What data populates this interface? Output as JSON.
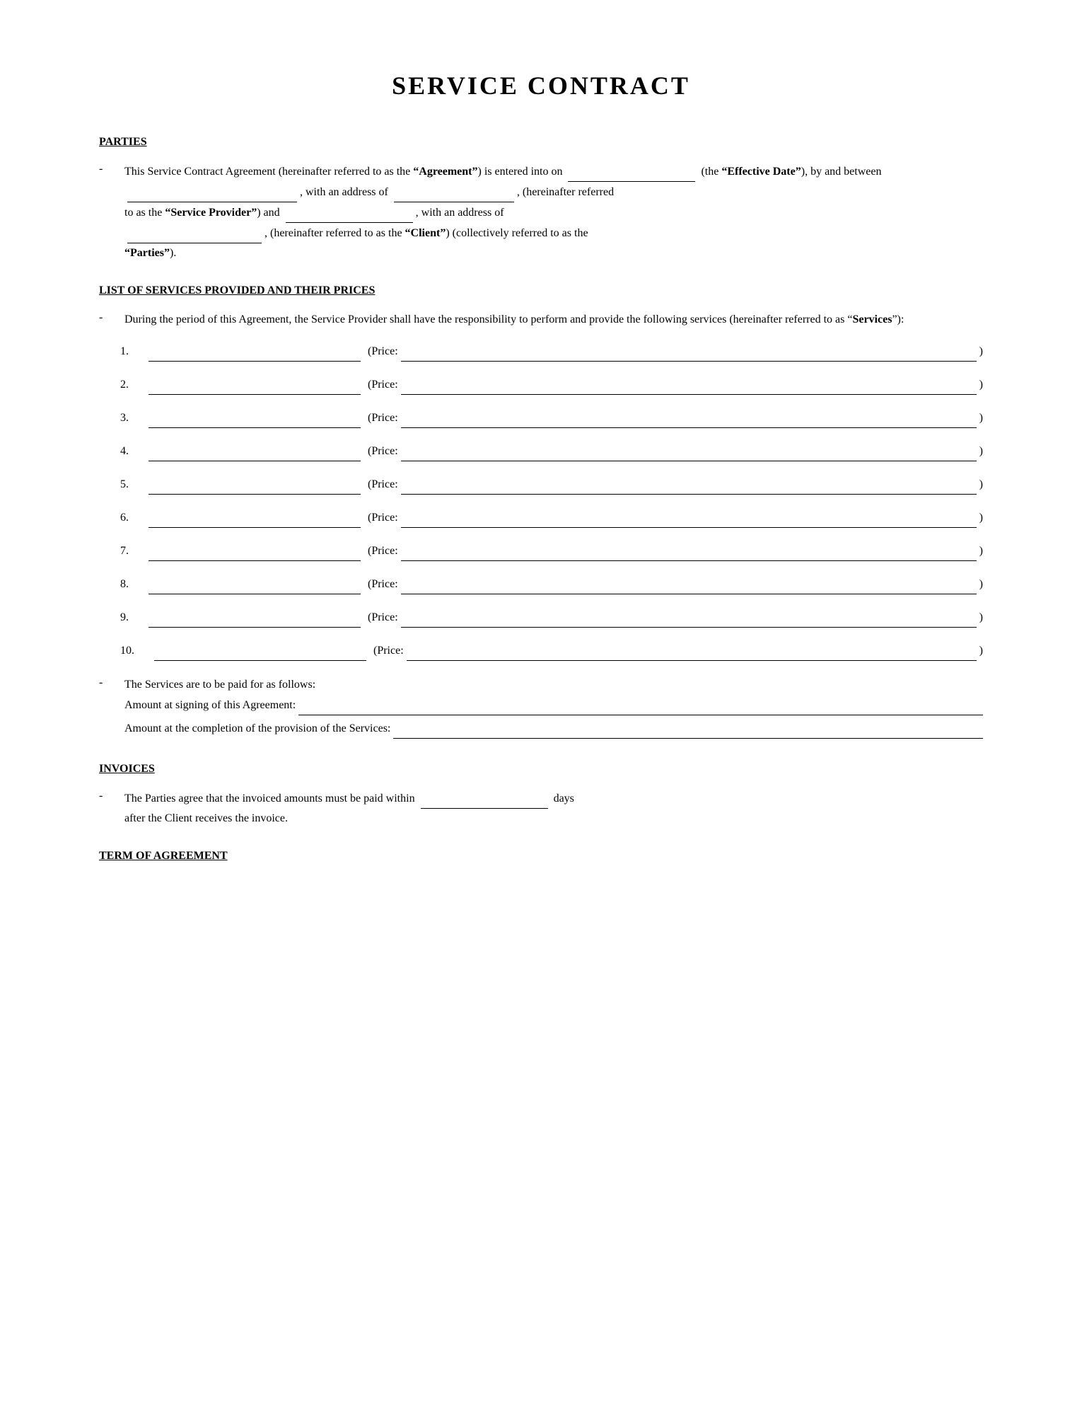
{
  "document": {
    "title": "SERVICE CONTRACT",
    "sections": {
      "parties": {
        "heading": "PARTIES",
        "paragraph": {
          "intro": "This Service Contract Agreement (hereinafter referred to as the",
          "agreement_term": "\"Agreement\"",
          "p1": ") is entered into on",
          "effective_date_term": "\"Effective Date\"",
          "p2": "), by and between",
          "p3": ", with an address of",
          "p4": ", (hereinafter referred to as",
          "service_provider_term": "\"Service Provider\"",
          "p5": ") and",
          "p6": ", with an address of",
          "p7": ", (hereinafter referred to as the",
          "client_term": "\"Client\"",
          "p8": ") (collectively referred to as the",
          "parties_term": "\"Parties\"",
          "p9": ")."
        }
      },
      "services": {
        "heading": "LIST OF SERVICES PROVIDED AND THEIR PRICES",
        "intro": "During the period of this Agreement, the Service Provider shall have the responsibility to perform and provide the following services (hereinafter referred to as “Services”):",
        "items": [
          {
            "num": "1."
          },
          {
            "num": "2."
          },
          {
            "num": "3."
          },
          {
            "num": "4."
          },
          {
            "num": "5."
          },
          {
            "num": "6."
          },
          {
            "num": "7."
          },
          {
            "num": "8."
          },
          {
            "num": "9."
          },
          {
            "num": "10."
          }
        ],
        "payment": {
          "intro": "The Services are to be paid for as follows:",
          "signing_label": "Amount at signing of this Agreement:",
          "completion_label": "Amount at the completion of the provision of the Services:"
        }
      },
      "invoices": {
        "heading": "INVOICES",
        "paragraph": "The Parties agree that the invoiced amounts must be paid within",
        "paragraph_end": "days after the Client receives the invoice."
      },
      "term": {
        "heading": "TERM OF AGREEMENT"
      }
    }
  }
}
